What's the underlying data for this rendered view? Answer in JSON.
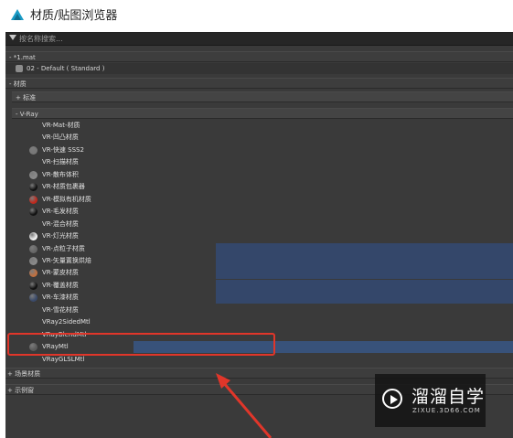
{
  "window": {
    "title": "材质/贴图浏览器"
  },
  "search": {
    "placeholder": "按名称搜索..."
  },
  "scene_file": {
    "name": "- *1.mat",
    "material": "02 - Default  ( Standard )"
  },
  "section_material": {
    "label": "- 材质"
  },
  "group_standard": {
    "label": "+ 标准"
  },
  "group_vray": {
    "label": "- V-Ray"
  },
  "vray_items": [
    {
      "label": "VR-Mat-材质",
      "ball": ""
    },
    {
      "label": "VR-凹凸材质",
      "ball": ""
    },
    {
      "label": "VR-快速 SSS2",
      "ball": "#777777"
    },
    {
      "label": "VR-扫描材质",
      "ball": ""
    },
    {
      "label": "VR-散布体积",
      "ball": "#8a8a8a"
    },
    {
      "label": "VR-材质包裹器",
      "ball": "#111111"
    },
    {
      "label": "VR-模拟有机材质",
      "ball": "#c0281c"
    },
    {
      "label": "VR-毛发材质",
      "ball": "#111111"
    },
    {
      "label": "VR-混合材质",
      "ball": ""
    },
    {
      "label": "VR-灯光材质",
      "ball": "#f2f2f2"
    },
    {
      "label": "VR-点粒子材质",
      "ball": "#666666"
    },
    {
      "label": "VR-矢量置换烘焙",
      "ball": "#8a8a8a"
    },
    {
      "label": "VR-蒙皮材质",
      "ball": "#c07040"
    },
    {
      "label": "VR-覆盖材质",
      "ball": "#111111"
    },
    {
      "label": "VR-车漆材质",
      "ball": "#3a4a6a"
    },
    {
      "label": "VR-雪花材质",
      "ball": ""
    },
    {
      "label": "VRay2SidedMtl",
      "ball": ""
    },
    {
      "label": "VRayBlendMtl",
      "ball": ""
    },
    {
      "label": "VRayMtl",
      "ball": "#5a5a5a"
    },
    {
      "label": "VRayGLSLMtl",
      "ball": ""
    }
  ],
  "group_scene_materials": {
    "label": "+ 场景材质"
  },
  "group_samples": {
    "label": "+ 示例窗"
  },
  "watermark": {
    "cn": "溜溜自学",
    "en": "ZIXUE.3D66.COM"
  },
  "colors": {
    "highlight": "#e0362a",
    "selection": "#38527a"
  }
}
